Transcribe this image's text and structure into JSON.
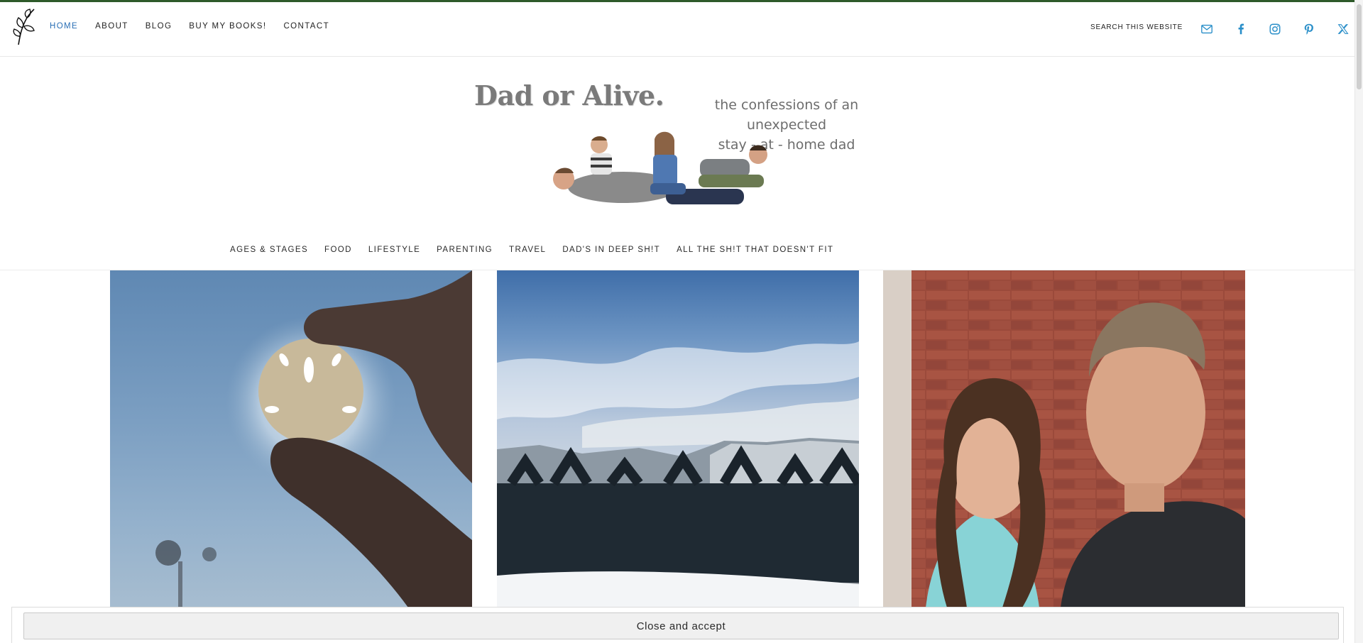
{
  "topbar": {
    "nav": [
      {
        "label": "HOME",
        "active": true
      },
      {
        "label": "ABOUT",
        "active": false
      },
      {
        "label": "BLOG",
        "active": false
      },
      {
        "label": "BUY MY BOOKS!",
        "active": false
      },
      {
        "label": "CONTACT",
        "active": false
      }
    ],
    "search_label": "SEARCH THIS WEBSITE",
    "social_icons": [
      "email-icon",
      "facebook-icon",
      "instagram-icon",
      "pinterest-icon",
      "x-twitter-icon"
    ],
    "accent_color": "#2a6fb5",
    "top_line_color": "#2e5a2a"
  },
  "hero": {
    "title": "Dad or Alive.",
    "tagline_line1": "the confessions of an unexpected",
    "tagline_line2": "stay - at - home dad"
  },
  "categories": [
    "AGES & STAGES",
    "FOOD",
    "LIFESTYLE",
    "PARENTING",
    "TRAVEL",
    "DAD'S IN DEEP SH!T",
    "ALL THE SH!T THAT DOESN'T FIT"
  ],
  "cookie": {
    "button_label": "Close and accept"
  }
}
